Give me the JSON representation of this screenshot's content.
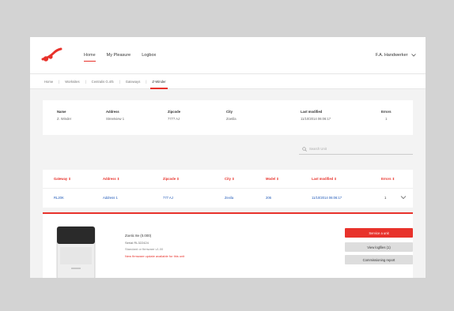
{
  "nav": {
    "home": "Home",
    "my_pleasures": "My Pleasure",
    "logbox": "Logbox",
    "user": "F.A. Handwerker"
  },
  "breadcrumb": [
    "Home",
    "Worksites",
    "Centralis G.4/5",
    "Gateways",
    "Z-Winder"
  ],
  "unit_info": {
    "headers": [
      "Name",
      "Address",
      "Zipcode",
      "City",
      "Last modified",
      "Errors"
    ],
    "values": [
      "Z. Winder",
      "Streetview 1",
      "7777 AJ",
      "Zoetila",
      "11/10/2014 06:06:17",
      "1"
    ]
  },
  "search": {
    "placeholder": "Search Unit"
  },
  "table": {
    "headers": [
      "Gateway",
      "Address",
      "Zipcode",
      "City",
      "Model",
      "Last modified",
      "Errors"
    ],
    "row": [
      "RL20K",
      "Address 1",
      "777 AJ",
      "Zevila",
      "206",
      "11/10/2014 06:06:17",
      "1"
    ]
  },
  "detail": {
    "title": "Zoetic 8e (0.000)",
    "serial": "Serial RL322424",
    "firmware": "Standard or firmware v1.00",
    "update_notice": "New firmware update available for this unit",
    "buttons": [
      "Service a unit",
      "View logfiles (1)",
      "Commissioning report"
    ]
  },
  "colors": {
    "accent": "#e8322b",
    "link": "#1f58b8"
  }
}
